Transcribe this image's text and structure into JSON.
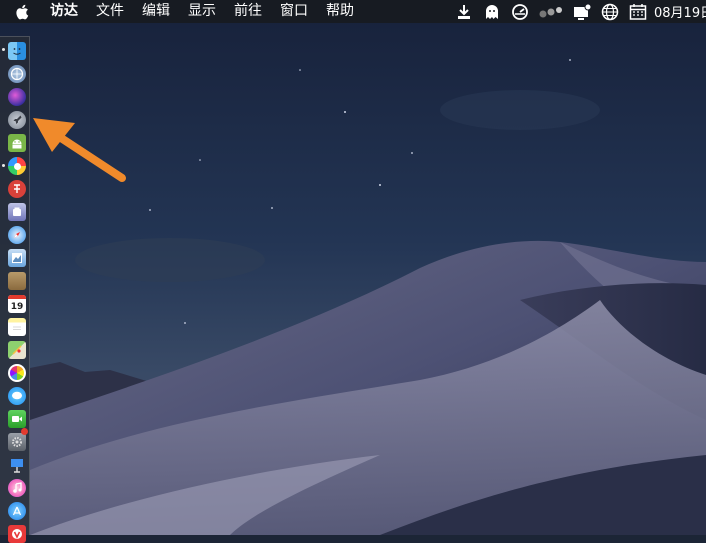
{
  "menubar": {
    "items": [
      "访达",
      "文件",
      "编辑",
      "显示",
      "前往",
      "窗口",
      "帮助"
    ],
    "clock": "08月19日"
  },
  "status_icons": [
    "download-icon",
    "ghost-icon",
    "dashboard-icon",
    "dots-icon",
    "notification-icon",
    "globe-icon",
    "calendar-icon"
  ],
  "dock": {
    "items": [
      {
        "name": "finder-icon"
      },
      {
        "name": "app-store-safari-icon"
      },
      {
        "name": "siri-icon"
      },
      {
        "name": "launchpad-icon"
      },
      {
        "name": "android-icon"
      },
      {
        "name": "color-wheel-icon"
      },
      {
        "name": "app-icon"
      },
      {
        "name": "screenshot-icon"
      },
      {
        "name": "safari-icon"
      },
      {
        "name": "preview-icon"
      },
      {
        "name": "notes-brown-icon"
      },
      {
        "name": "calendar-dock-icon",
        "label": "19"
      },
      {
        "name": "notes-icon"
      },
      {
        "name": "maps-icon"
      },
      {
        "name": "photos-icon"
      },
      {
        "name": "messages-icon"
      },
      {
        "name": "facetime-icon"
      },
      {
        "name": "system-preferences-icon"
      },
      {
        "name": "keynote-icon"
      },
      {
        "name": "itunes-icon"
      },
      {
        "name": "app-store-icon"
      },
      {
        "name": "vivaldi-icon"
      }
    ]
  },
  "colors": {
    "menubar": "#171b22",
    "arrow": "#f08a2b"
  }
}
